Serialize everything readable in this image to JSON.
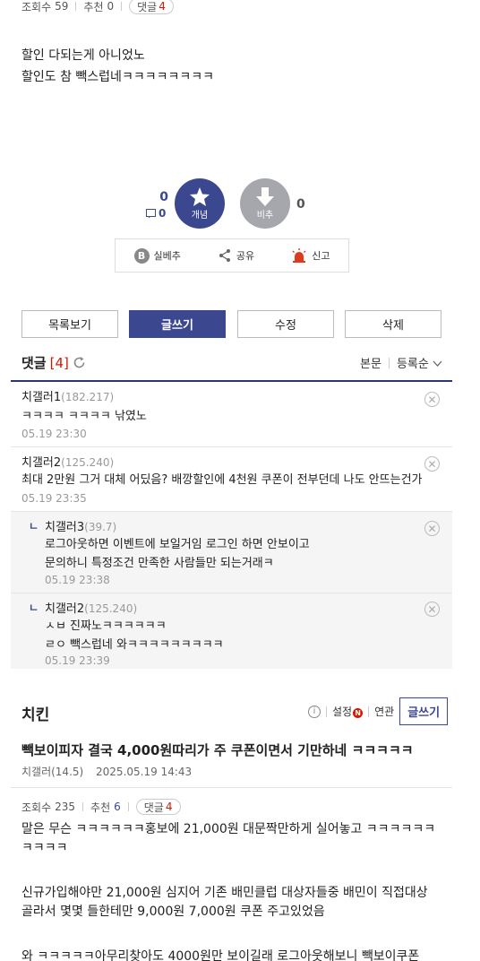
{
  "post": {
    "views_label": "조회수",
    "views": "59",
    "rec_label": "추천",
    "rec": "0",
    "comments_label": "댓글",
    "comments": "4",
    "body_lines": [
      "할인 다되는게 아니었노",
      "할인도 참 빽스럽네ㅋㅋㅋㅋㅋㅋㅋㅋ"
    ]
  },
  "vote": {
    "up_count": "0",
    "cmt_count": "0",
    "down_count": "0",
    "up_label": "개념",
    "down_label": "비추"
  },
  "tools": {
    "silbe": "실베추",
    "share": "공유",
    "report": "신고",
    "b_letter": "B"
  },
  "actions": {
    "list": "목록보기",
    "write": "글쓰기",
    "edit": "수정",
    "delete": "삭제"
  },
  "comments_header": {
    "title": "댓글",
    "count": "[4]",
    "sort_body": "본문",
    "sort_order": "등록순"
  },
  "comments": [
    {
      "author": "치갤러1",
      "ip": "(182.217)",
      "text": "ㅋㅋㅋㅋ ㅋㅋㅋㅋ 낚였노",
      "date": "05.19 23:30"
    },
    {
      "author": "치갤러2",
      "ip": "(125.240)",
      "text": "최대 2만원 그거 대체 어딨음? 배깡할인에 4천원 쿠폰이 전부던데 나도 안뜨는건가",
      "date": "05.19 23:35"
    },
    {
      "author": "치갤러3",
      "ip": "(39.7)",
      "line1": "로그아웃하면 이벤트에 보일거임 로그인 하면 안보이고",
      "line2": "문의하니 특정조건 만족한 사람들만 되는거래ㅋ",
      "date": "05.19 23:38"
    },
    {
      "author": "치갤러2",
      "ip": "(125.240)",
      "line1": "ㅅㅂ 진짜노ㅋㅋㅋㅋㅋㅋ",
      "line2": "ㄹㅇ 빽스럽네 와ㅋㅋㅋㅋㅋㅋㅋㅋㅋ",
      "date": "05.19 23:39"
    }
  ],
  "board": {
    "title": "치킨",
    "settings": "설정",
    "n": "N",
    "related": "연관",
    "write": "글쓰기"
  },
  "post2": {
    "title": "빽보이피자 결국 4,000원따리가 주 쿠폰이면서 기만하네 ㅋㅋㅋㅋㅋ",
    "author": "치갤러(14.5)",
    "date": "2025.05.19 14:43",
    "views_label": "조회수",
    "views": "235",
    "rec_label": "추천",
    "rec": "6",
    "comments_label": "댓글",
    "comments": "4",
    "para1a": "말은 무슨 ㅋㅋㅋㅋㅋㅋ홍보에 21,000원 대문짝만하게 실어놓고 ㅋㅋㅋㅋㅋㅋ",
    "para1b": "ㅋㅋㅋㅋ",
    "para2a": "신규가입해야만 21,000원   심지어  기존 배민클럽 대상자들중 배민이 직접대상",
    "para2b": "골라서 몇몇 들한테만 9,000원 7,000원 쿠폰 주고있었음",
    "para3": "와 ㅋㅋㅋㅋㅋ아무리찾아도 4000원만 보이길래  로그아웃해보니 빽보이쿠폰"
  }
}
